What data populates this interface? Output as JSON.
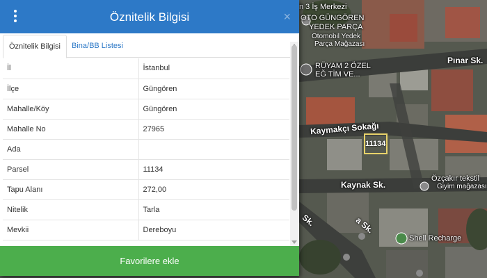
{
  "dialog": {
    "title": "Öznitelik Bilgisi",
    "header_color": "#2d79c7",
    "menu_icon": "vertical-dots-icon",
    "close_icon": "close-icon",
    "close_label": "×"
  },
  "tabs": [
    {
      "label": "Öznitelik Bilgisi",
      "active": true
    },
    {
      "label": "Bina/BB Listesi",
      "active": false
    }
  ],
  "attributes": [
    {
      "key": "İl",
      "value": "İstanbul"
    },
    {
      "key": "İlçe",
      "value": "Güngören"
    },
    {
      "key": "Mahalle/Köy",
      "value": "Güngören"
    },
    {
      "key": "Mahalle No",
      "value": "27965"
    },
    {
      "key": "Ada",
      "value": ""
    },
    {
      "key": "Parsel",
      "value": "11134"
    },
    {
      "key": "Tapu Alanı",
      "value": "272,00"
    },
    {
      "key": "Nitelik",
      "value": "Tarla"
    },
    {
      "key": "Mevkii",
      "value": "Dereboyu"
    }
  ],
  "favorite_button": {
    "label": "Favorilere ekle",
    "color": "#4cae4c"
  },
  "map": {
    "labels": {
      "is_merkezi": "n 3 İş Merkezi",
      "oto_gungoren": "OTO GÜNGÖREN",
      "yedek_parca": "YEDEK PARÇA",
      "otomobil_yedek": "Otomobil Yedek",
      "parca_magazasi": "Parça Mağazası",
      "ruyam": "RÜYAM 2 ÖZEL",
      "egitim": "EĞ TİM VE...",
      "pinar": "Pınar Sk.",
      "kaymakci": "Kaymakçı Sokağı",
      "kaynak": "Kaynak Sk.",
      "ozcakir": "Özçakır tekstil",
      "giyim": "Giyim mağazası",
      "shell": "Shell Recharge",
      "sk_left": "Sk.",
      "sk_bottom": "a Sk."
    },
    "parcel_label": "11134",
    "parcel_color": "#e8d36a"
  }
}
